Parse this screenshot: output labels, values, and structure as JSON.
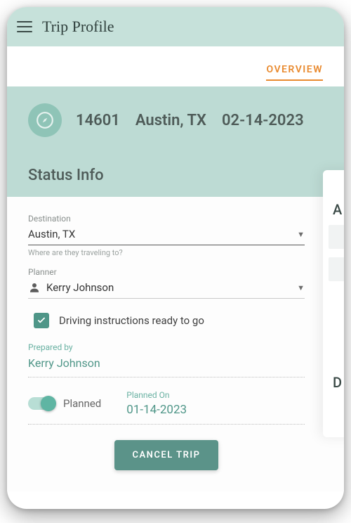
{
  "header": {
    "title": "Trip Profile"
  },
  "tabs": {
    "active": "OVERVIEW"
  },
  "hero": {
    "id": "14601",
    "destination": "Austin, TX",
    "date": "02-14-2023"
  },
  "status": {
    "section_title": "Status Info",
    "destination": {
      "label": "Destination",
      "value": "Austin, TX",
      "help": "Where are they traveling to?"
    },
    "planner": {
      "label": "Planner",
      "value": "Kerry Johnson"
    },
    "driving_ready": {
      "checked": true,
      "label": "Driving instructions ready to go"
    },
    "prepared_by": {
      "label": "Prepared by",
      "value": "Kerry Johnson"
    },
    "planned": {
      "toggle_on": true,
      "toggle_label": "Planned",
      "planned_on_label": "Planned On",
      "planned_on_value": "01-14-2023"
    },
    "cancel_label": "CANCEL TRIP"
  },
  "side_panel": {
    "letter_a": "A",
    "letter_d": "D"
  }
}
